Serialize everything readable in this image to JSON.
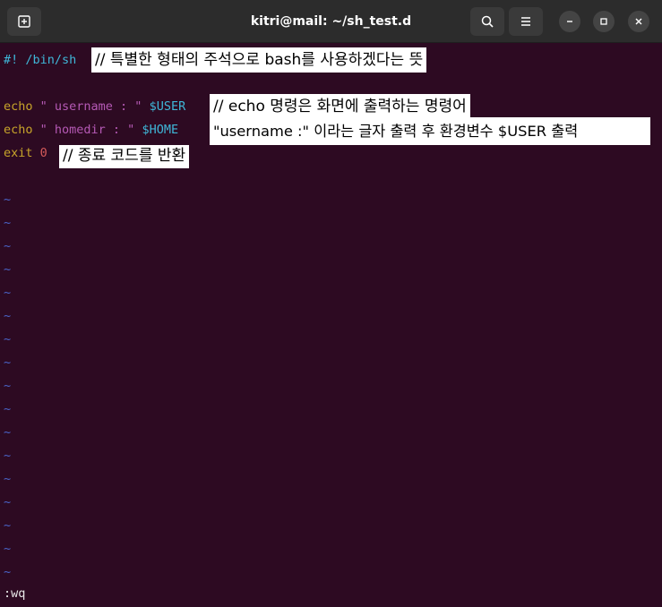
{
  "window": {
    "title": "kitri@mail: ~/sh_test.d"
  },
  "editor": {
    "shebang": {
      "hash": "#!",
      "path": " /bin/sh"
    },
    "lines": [
      {
        "keyword": "echo",
        "string": " \" username : \" ",
        "var": "$USER"
      },
      {
        "keyword": "echo",
        "string": " \" homedir : \" ",
        "var": "$HOME"
      },
      {
        "keyword": "exit",
        "code": " 0"
      }
    ],
    "tilde": "~",
    "command_line": ":wq"
  },
  "annotations": {
    "shebang_note": "// 특별한 형태의 주석으로 bash를 사용하겠다는 뜻",
    "echo_note_1": "// echo 명령은 화면에 출력하는 명령어",
    "echo_note_2": "\"username :\" 이라는 글자 출력 후 환경변수 $USER 출력",
    "exit_note": "// 종료 코드를 반환"
  }
}
